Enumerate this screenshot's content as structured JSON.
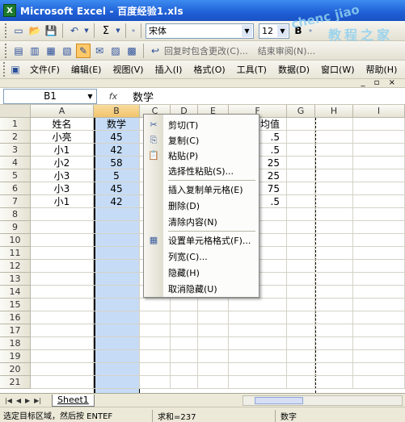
{
  "window": {
    "title": "Microsoft Excel - 百度经验1.xls"
  },
  "toolbar2": {
    "font_name": "宋体",
    "font_size": "12",
    "bold_label": "B",
    "review_reply": "回复时包含更改(C)...",
    "end_review": "结束审阅(N)..."
  },
  "toolbar1": {
    "sigma": "Σ"
  },
  "menu": {
    "items": [
      "文件(F)",
      "编辑(E)",
      "视图(V)",
      "插入(I)",
      "格式(O)",
      "工具(T)",
      "数据(D)",
      "窗口(W)",
      "帮助(H)"
    ]
  },
  "formula_bar": {
    "name_box": "B1",
    "fx": "fx",
    "content": "数学"
  },
  "grid": {
    "columns": [
      "A",
      "B",
      "C",
      "D",
      "E",
      "F",
      "G",
      "H",
      "I"
    ],
    "rows": [
      "1",
      "2",
      "3",
      "4",
      "5",
      "6",
      "7",
      "8",
      "9",
      "10",
      "11",
      "12",
      "13",
      "14",
      "15",
      "16",
      "17",
      "18",
      "19",
      "20",
      "21"
    ],
    "col_a": [
      "姓名",
      "小亮",
      "小1",
      "小2",
      "小3",
      "小3",
      "小1"
    ],
    "col_b": [
      "数学",
      "45",
      "42",
      "58",
      "5",
      "45",
      "42"
    ],
    "col_f": [
      "平均值",
      ".5",
      ".5",
      "25",
      "25",
      "75",
      ".5"
    ]
  },
  "context_menu": {
    "items": [
      {
        "icon": "✂",
        "label": "剪切(T)"
      },
      {
        "icon": "⎘",
        "label": "复制(C)"
      },
      {
        "icon": "📋",
        "label": "粘贴(P)"
      },
      {
        "icon": "",
        "label": "选择性粘贴(S)..."
      },
      {
        "icon": "",
        "label": "插入复制单元格(E)"
      },
      {
        "icon": "",
        "label": "删除(D)"
      },
      {
        "icon": "",
        "label": "清除内容(N)"
      },
      {
        "icon": "▦",
        "label": "设置单元格格式(F)..."
      },
      {
        "icon": "",
        "label": "列宽(C)..."
      },
      {
        "icon": "",
        "label": "隐藏(H)"
      },
      {
        "icon": "",
        "label": "取消隐藏(U)"
      }
    ]
  },
  "sheet_tabs": [
    "Sheet1"
  ],
  "status": {
    "message": "选定目标区域，然后按 ENTEF",
    "sum": "求和=237",
    "num": "数字"
  },
  "watermark": {
    "line1": "chenc",
    "line2": "jiao",
    "line3": "教",
    "line4": "程",
    "line5": "之",
    "line6": "家"
  }
}
